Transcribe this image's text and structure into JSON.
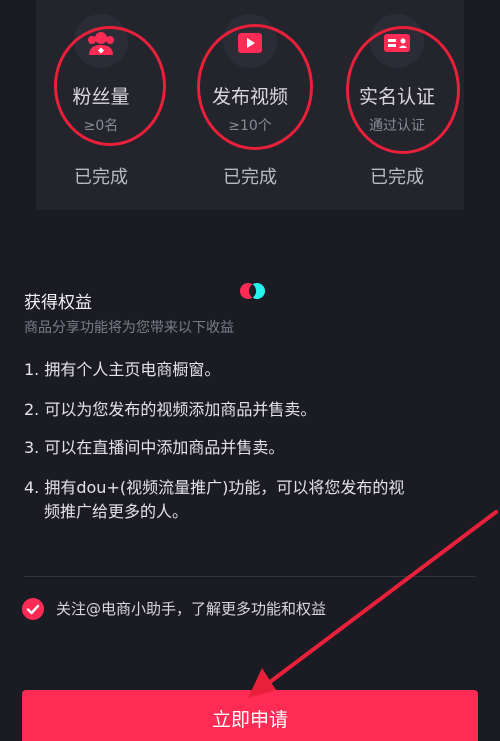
{
  "requirements": [
    {
      "title": "粉丝量",
      "sub": "≥0名",
      "status": "已完成",
      "icon": "fans-icon"
    },
    {
      "title": "发布视频",
      "sub": "≥10个",
      "status": "已完成",
      "icon": "video-icon"
    },
    {
      "title": "实名认证",
      "sub": "通过认证",
      "status": "已完成",
      "icon": "id-card-icon"
    }
  ],
  "benefits_section": {
    "title": "获得权益",
    "subtitle": "商品分享功能将为您带来以下收益",
    "items": [
      "1. 拥有个人主页电商橱窗。",
      "2. 可以为您发布的视频添加商品并售卖。",
      "3. 可以在直播间中添加商品并售卖。",
      "4. 拥有dou+(视频流量推广)功能，可以将您发布的视",
      "频推广给更多的人。"
    ]
  },
  "agreement": {
    "text": "关注@电商小助手，了解更多功能和权益",
    "checked": true
  },
  "apply_button": {
    "label": "立即申请"
  },
  "colors": {
    "accent": "#fe2c55",
    "annotation_red": "#e8203a",
    "background": "#1b1b23"
  }
}
